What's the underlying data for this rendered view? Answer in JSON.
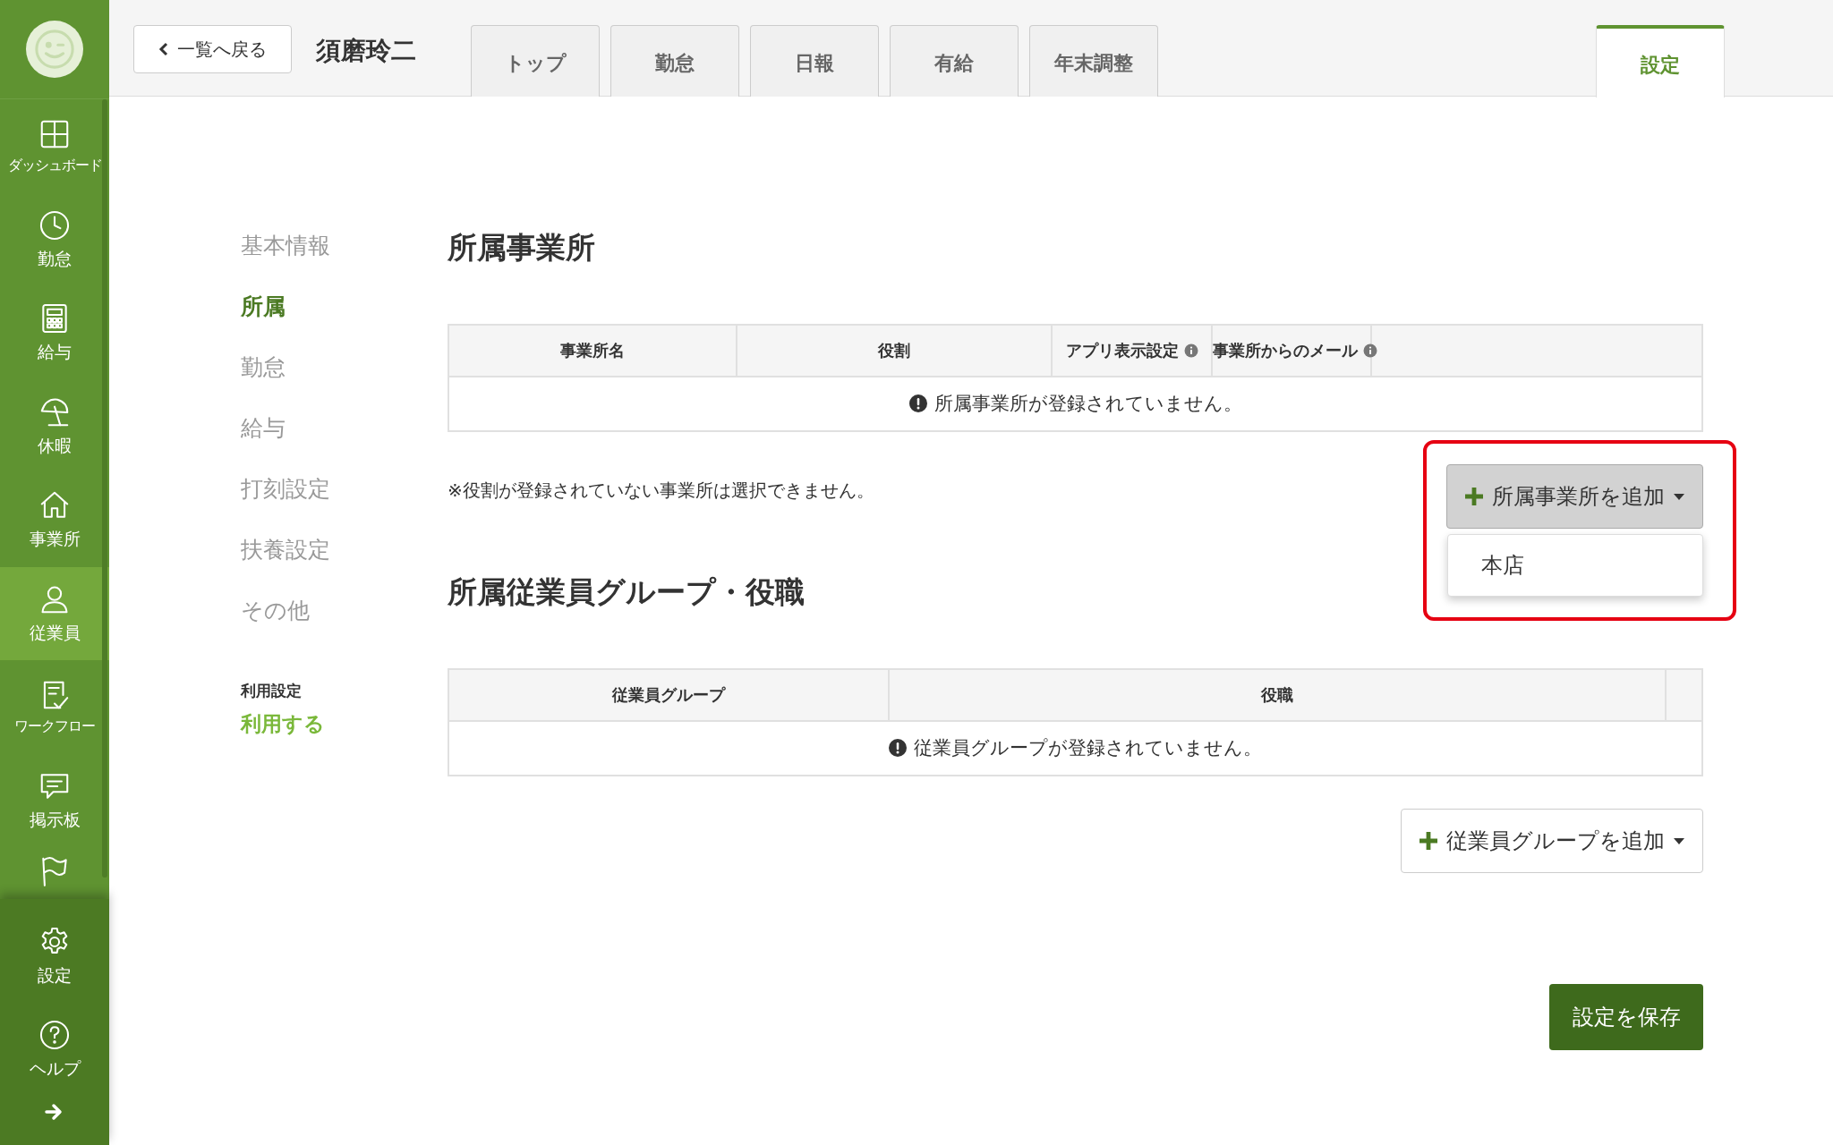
{
  "sidebar": {
    "items": [
      {
        "label": "ダッシュボード",
        "selected": false
      },
      {
        "label": "勤怠",
        "selected": false
      },
      {
        "label": "給与",
        "selected": false
      },
      {
        "label": "休暇",
        "selected": false
      },
      {
        "label": "事業所",
        "selected": false
      },
      {
        "label": "従業員",
        "selected": true
      },
      {
        "label": "ワークフロー",
        "selected": false
      },
      {
        "label": "掲示板",
        "selected": false
      }
    ],
    "bottom_items": [
      {
        "label": "設定"
      },
      {
        "label": "ヘルプ"
      }
    ]
  },
  "header": {
    "back_button": "一覧へ戻る",
    "employee_name": "須磨玲二",
    "tabs": [
      {
        "label": "トップ",
        "selected": false
      },
      {
        "label": "勤怠",
        "selected": false
      },
      {
        "label": "日報",
        "selected": false
      },
      {
        "label": "有給",
        "selected": false
      },
      {
        "label": "年末調整",
        "selected": false
      }
    ],
    "settings_tab": {
      "label": "設定",
      "selected": true
    }
  },
  "settings_nav": {
    "items": [
      {
        "label": "基本情報",
        "selected": false
      },
      {
        "label": "所属",
        "selected": true
      },
      {
        "label": "勤怠",
        "selected": false
      },
      {
        "label": "給与",
        "selected": false
      },
      {
        "label": "打刻設定",
        "selected": false
      },
      {
        "label": "扶養設定",
        "selected": false
      },
      {
        "label": "その他",
        "selected": false
      }
    ],
    "usage": {
      "label": "利用設定",
      "value": "利用する"
    }
  },
  "offices": {
    "title": "所属事業所",
    "columns": [
      {
        "label": "事業所名",
        "info": false
      },
      {
        "label": "役割",
        "info": false
      },
      {
        "label": "アプリ表示設定",
        "info": true
      },
      {
        "label": "事業所からのメール",
        "info": true
      }
    ],
    "empty_message": "所属事業所が登録されていません。",
    "note": "※役割が登録されていない事業所は選択できません。",
    "add_button": {
      "label": "所属事業所を追加",
      "open": true,
      "highlighted": true
    },
    "menu": [
      {
        "label": "本店"
      }
    ]
  },
  "groups": {
    "title": "所属従業員グループ・役職",
    "columns": [
      {
        "label": "従業員グループ",
        "info": false
      },
      {
        "label": "役職",
        "info": false
      }
    ],
    "empty_message": "従業員グループが登録されていません。",
    "add_button": {
      "label": "従業員グループを追加",
      "open": false
    }
  },
  "save_button": "設定を保存"
}
